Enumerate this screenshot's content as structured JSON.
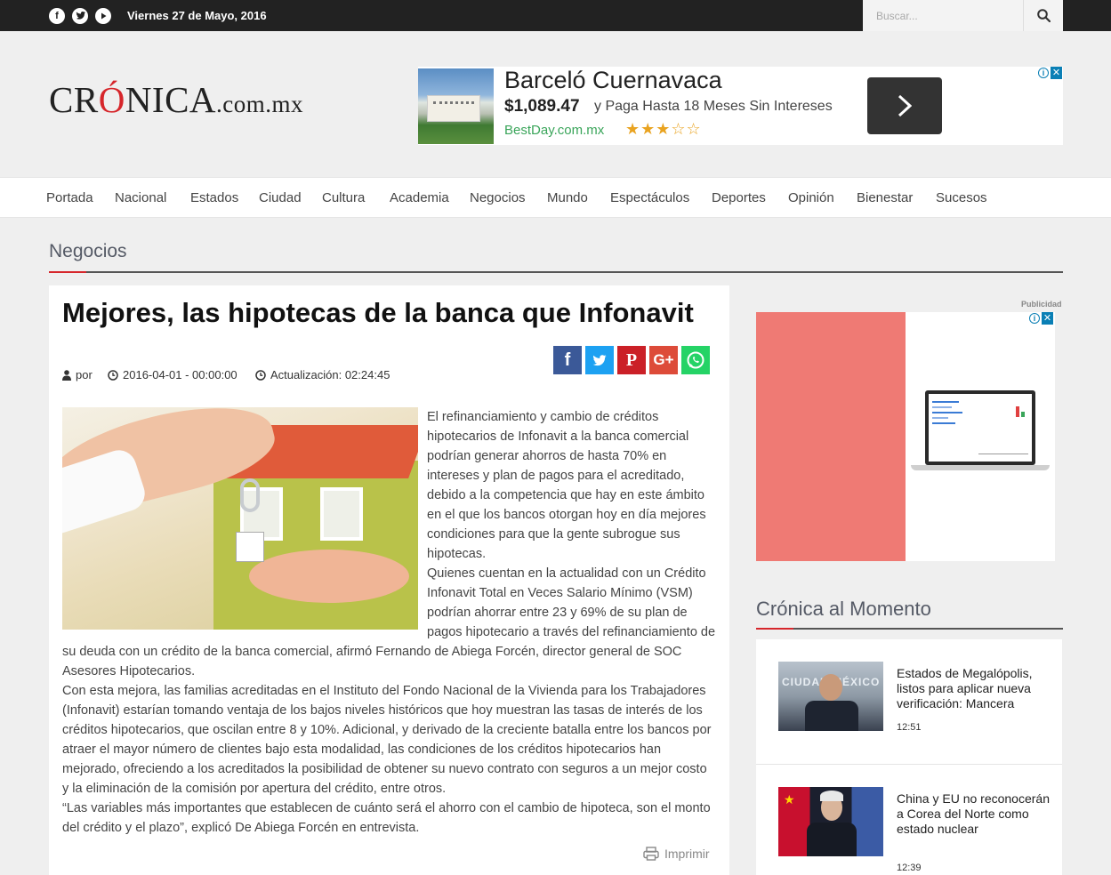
{
  "topbar": {
    "date": "Viernes 27 de Mayo, 2016",
    "search_placeholder": "Buscar...",
    "social_icons": [
      "facebook-icon",
      "twitter-icon",
      "youtube-icon"
    ]
  },
  "logo": {
    "pre": "CR",
    "accent": "Ó",
    "post": "NICA",
    "domain": ".com.mx"
  },
  "ad_top": {
    "title": "Barceló Cuernavaca",
    "price": "$1,089.47",
    "description": "y Paga Hasta 18 Meses Sin Intereses",
    "site": "BestDay.com.mx",
    "rating": 3,
    "rating_max": 5
  },
  "nav": {
    "items": [
      "Portada",
      "Nacional",
      "Estados",
      "Ciudad",
      "Cultura",
      "Academia",
      "Negocios",
      "Mundo",
      "Espectáculos",
      "Deportes",
      "Opinión",
      "Bienestar",
      "Sucesos"
    ]
  },
  "section": {
    "title": "Negocios"
  },
  "article": {
    "title": "Mejores, las hipotecas de la banca que Infonavit",
    "author_label": "por",
    "date": "2016-04-01 - 00:00:00",
    "updated": "Actualización: 02:24:45",
    "share": [
      "facebook-icon",
      "twitter-icon",
      "pinterest-icon",
      "google-plus-icon",
      "whatsapp-icon"
    ],
    "paragraphs": [
      "El refinanciamiento y cambio de créditos hipotecarios de Infonavit a la banca comercial podrían generar ahorros de hasta 70% en intereses y plan de pagos para el acreditado, debido a la competencia que hay en este ámbito en el que los bancos otorgan hoy en día mejores condiciones para que la gente subrogue sus hipotecas.",
      "Quienes cuentan en la actualidad con un Crédito Infonavit Total en Veces Salario Mínimo (VSM) podrían ahorrar entre 23 y 69% de su plan de pagos hipotecario a través del refinanciamiento de su deuda con un crédito de la banca comercial, afirmó Fernando de Abiega Forcén, director general de SOC Asesores Hipotecarios.",
      "Con esta mejora, las familias acreditadas en el Instituto del Fondo Nacional de la Vivienda para los Trabajadores (Infonavit) estarían tomando ventaja de los bajos niveles históricos que hoy muestran las tasas de interés de los créditos hipotecarios, que oscilan entre 8 y 10%. Adicional, y derivado de la creciente batalla entre los bancos por atraer el mayor número de clientes bajo esta modalidad, las condiciones de los créditos hipotecarios han mejorado, ofreciendo a los acreditados la posibilidad de obtener su nuevo contrato con seguros a un mejor costo y la eliminación de la comisión por apertura del crédito, entre otros.",
      "“Las variables más importantes que establecen de cuánto será el ahorro con el cambio de hipoteca, son el monto del crédito y el plazo”, explicó De Abiega Forcén en entrevista."
    ],
    "print_label": "Imprimir"
  },
  "sidebar": {
    "ad_label": "Publicidad",
    "title": "Crónica al Momento",
    "items": [
      {
        "headline": "Estados de Megalópolis, listos para aplicar nueva verificación: Mancera",
        "time": "12:51",
        "thumb_text": "CIUDAD MÉXICO"
      },
      {
        "headline": "China y EU no reconocerán a Corea del Norte como estado nuclear",
        "time": "12:39"
      }
    ]
  },
  "colors": {
    "brand_red": "#d6262b",
    "topbar": "#222222",
    "section_gray": "#555a66"
  }
}
